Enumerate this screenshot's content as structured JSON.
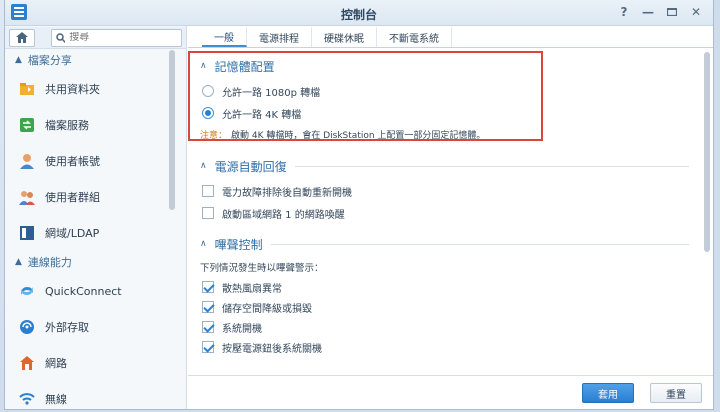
{
  "window": {
    "title": "控制台"
  },
  "sidebar": {
    "search_placeholder": "搜尋",
    "sections": [
      {
        "label": "檔案分享",
        "items": [
          {
            "label": "共用資料夾",
            "icon": "folder-share-icon"
          },
          {
            "label": "檔案服務",
            "icon": "file-services-icon"
          },
          {
            "label": "使用者帳號",
            "icon": "user-icon"
          },
          {
            "label": "使用者群組",
            "icon": "user-group-icon"
          },
          {
            "label": "網域/LDAP",
            "icon": "domain-ldap-icon"
          }
        ]
      },
      {
        "label": "連線能力",
        "items": [
          {
            "label": "QuickConnect",
            "icon": "quickconnect-icon"
          },
          {
            "label": "外部存取",
            "icon": "external-access-icon"
          },
          {
            "label": "網路",
            "icon": "network-icon"
          },
          {
            "label": "無線",
            "icon": "wireless-icon"
          }
        ]
      }
    ]
  },
  "tabs": [
    {
      "label": "一般",
      "active": true
    },
    {
      "label": "電源排程",
      "active": false
    },
    {
      "label": "硬碟休眠",
      "active": false
    },
    {
      "label": "不斷電系統",
      "active": false
    }
  ],
  "groups": {
    "memory": {
      "title": "記憶體配置",
      "options": [
        {
          "label": "允許一路 1080p 轉檔",
          "selected": false
        },
        {
          "label": "允許一路 4K 轉檔",
          "selected": true
        }
      ],
      "note_label": "注意：",
      "note_text": "啟動 4K 轉檔時，會在 DiskStation 上配置一部分固定記憶體。"
    },
    "power_recovery": {
      "title": "電源自動回復",
      "options": [
        {
          "label": "電力故障排除後自動重新開機",
          "checked": false
        },
        {
          "label": "啟動區域網路 1 的網路喚醒",
          "checked": false
        }
      ]
    },
    "beep": {
      "title": "嗶聲控制",
      "intro": "下列情況發生時以嗶聲警示：",
      "options": [
        {
          "label": "散熱風扇異常",
          "checked": true
        },
        {
          "label": "儲存空間降級或損毀",
          "checked": true
        },
        {
          "label": "系統開機",
          "checked": true
        },
        {
          "label": "按壓電源鈕後系統關機",
          "checked": true
        }
      ]
    }
  },
  "footer": {
    "apply_label": "套用",
    "reset_label": "重置"
  },
  "colors": {
    "accent": "#2b7fd0",
    "highlight_border": "#d9463a",
    "note_label": "#d07a15"
  }
}
